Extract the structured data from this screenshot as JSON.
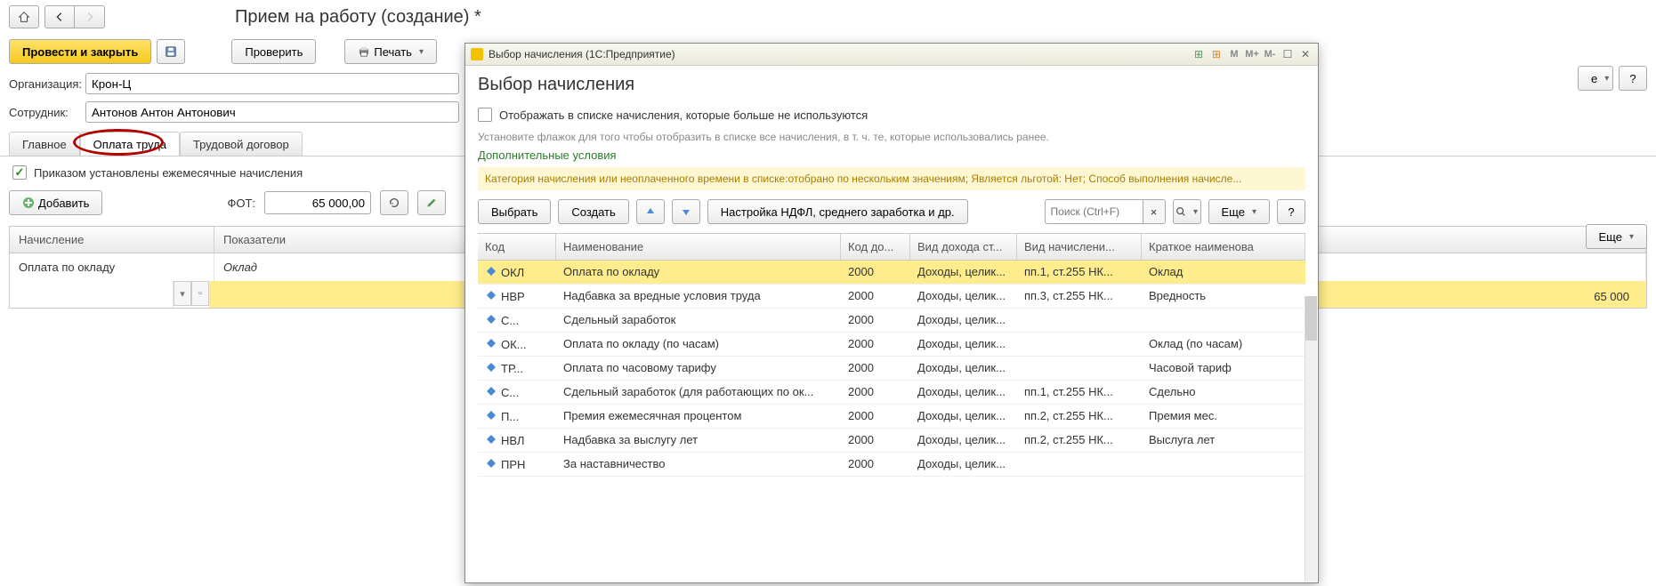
{
  "page": {
    "title": "Прием на работу (создание) *"
  },
  "toolbar": {
    "post_and_close": "Провести и закрыть",
    "check": "Проверить",
    "print": "Печать"
  },
  "fields": {
    "org_label": "Организация:",
    "org_value": "Крон-Ц",
    "emp_label": "Сотрудник:",
    "emp_value": "Антонов Антон Антонович"
  },
  "tabs": {
    "main": "Главное",
    "pay": "Оплата труда",
    "contract": "Трудовой договор"
  },
  "monthly_check": {
    "label": "Приказом установлены ежемесячные начисления",
    "checked": true
  },
  "subbar": {
    "add": "Добавить",
    "fot_label": "ФОТ:",
    "fot_value": "65 000,00"
  },
  "grid": {
    "headers": {
      "accrual": "Начисление",
      "indicators": "Показатели"
    },
    "row": {
      "accrual": "Оплата по окладу",
      "indicator": "Оклад"
    }
  },
  "right": {
    "more_arrow": "е",
    "help": "?",
    "more": "Еще",
    "amount": "65 000"
  },
  "dialog": {
    "win_title": "Выбор начисления  (1С:Предприятие)",
    "heading": "Выбор начисления",
    "check_label": "Отображать в списке начисления, которые больше не используются",
    "hint": "Установите флажок для того чтобы отобразить в списке все начисления, в т. ч. те, которые использовались ранее.",
    "extra_conditions": "Дополнительные условия",
    "filter_text": "Категория начисления или неоплаченного времени в списке:отобрано по нескольким значениям; Является льготой: Нет; Способ выполнения начисле...",
    "buttons": {
      "select": "Выбрать",
      "create": "Создать",
      "config": "Настройка НДФЛ, среднего заработка и др.",
      "search_ph": "Поиск (Ctrl+F)",
      "more": "Еще",
      "help": "?"
    },
    "columns": {
      "code": "Код",
      "name": "Наименование",
      "kod": "Код до...",
      "vid": "Вид дохода ст...",
      "vn": "Вид начислени...",
      "kn": "Краткое наименова"
    },
    "rows": [
      {
        "code": "ОКЛ",
        "name": "Оплата по окладу",
        "kod": "2000",
        "vid": "Доходы, целик...",
        "vn": "пп.1, ст.255 НК...",
        "kn": "Оклад",
        "sel": true
      },
      {
        "code": "НВР",
        "name": "Надбавка за вредные условия труда",
        "kod": "2000",
        "vid": "Доходы, целик...",
        "vn": "пп.3, ст.255 НК...",
        "kn": "Вредность"
      },
      {
        "code": "С...",
        "name": "Сдельный заработок",
        "kod": "2000",
        "vid": "Доходы, целик...",
        "vn": "",
        "kn": ""
      },
      {
        "code": "ОК...",
        "name": "Оплата по окладу (по часам)",
        "kod": "2000",
        "vid": "Доходы, целик...",
        "vn": "",
        "kn": "Оклад (по часам)"
      },
      {
        "code": "ТР...",
        "name": "Оплата по часовому тарифу",
        "kod": "2000",
        "vid": "Доходы, целик...",
        "vn": "",
        "kn": "Часовой тариф"
      },
      {
        "code": "С...",
        "name": "Сдельный заработок (для работающих по ок...",
        "kod": "2000",
        "vid": "Доходы, целик...",
        "vn": "пп.1, ст.255 НК...",
        "kn": "Сдельно"
      },
      {
        "code": "П...",
        "name": "Премия ежемесячная процентом",
        "kod": "2000",
        "vid": "Доходы, целик...",
        "vn": "пп.2, ст.255 НК...",
        "kn": "Премия мес."
      },
      {
        "code": "НВЛ",
        "name": "Надбавка за выслугу лет",
        "kod": "2000",
        "vid": "Доходы, целик...",
        "vn": "пп.2, ст.255 НК...",
        "kn": "Выслуга лет"
      },
      {
        "code": "ПРН",
        "name": "За наставничество",
        "kod": "2000",
        "vid": "Доходы, целик...",
        "vn": "",
        "kn": ""
      }
    ]
  }
}
